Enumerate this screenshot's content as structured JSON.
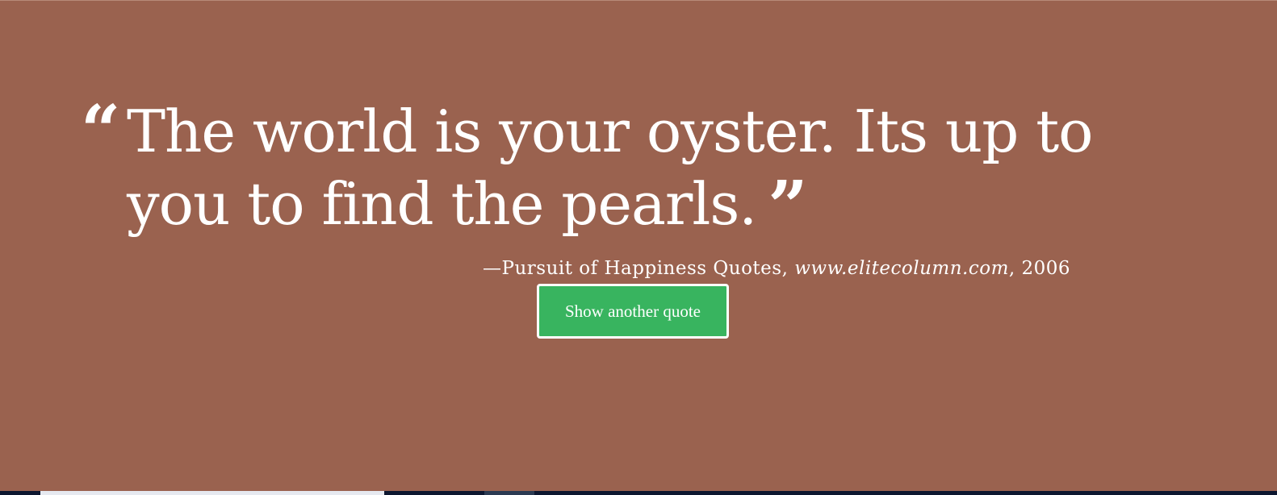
{
  "quote": {
    "open_mark": "“",
    "text": "The world is your oyster. Its up to you to find the pearls.",
    "close_mark": "”"
  },
  "attribution": {
    "prefix": "—Pursuit of Happiness Quotes, ",
    "site": "www.elitecolumn.com",
    "suffix": ", 2006"
  },
  "button": {
    "label": "Show another quote"
  },
  "colors": {
    "background": "#9a624f",
    "button": "#38b45f",
    "text": "#ffffff"
  }
}
